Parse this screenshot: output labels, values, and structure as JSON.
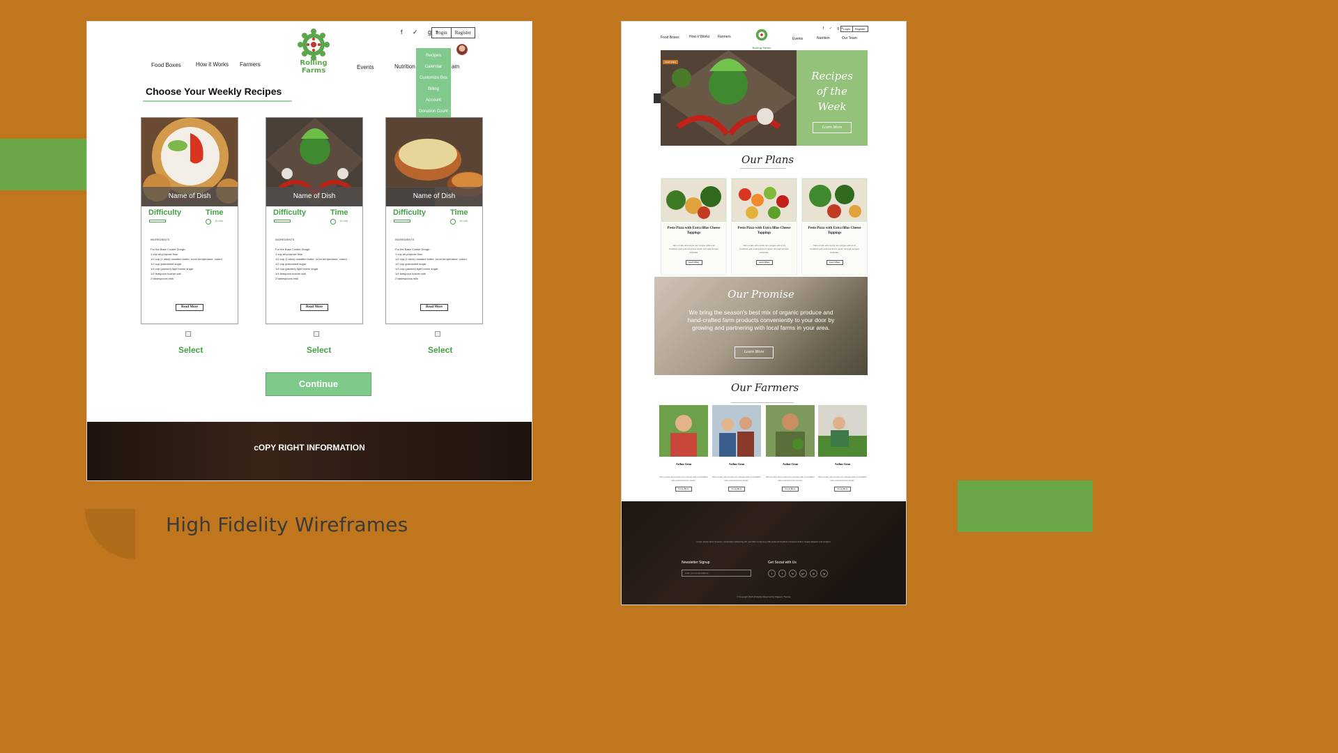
{
  "caption": "High Fidelity Wireframes",
  "colors": {
    "background": "#bf761c",
    "accent_green": "#6aa847",
    "button_green": "#7fc98a",
    "text_green": "#43a047"
  },
  "left": {
    "social_icons": [
      "facebook-icon",
      "twitter-icon",
      "google-plus-icon"
    ],
    "social_glyphs": "f  ✓  g+",
    "login": "Login",
    "register": "Register",
    "nav": {
      "food_boxes": "Food Boxes",
      "how_it_works": "How it Works",
      "farmers": "Farmers",
      "events": "Events",
      "nutrition": "Nutrition",
      "team_partial": "am"
    },
    "brand": "Rolling Farms",
    "dropdown": [
      "Recipes",
      "Calendar",
      "Customize Box",
      "Billing",
      "Account",
      "Donation Count"
    ],
    "heading": "Choose Your Weekly  Recipes",
    "cards": [
      {
        "name": "Name of Dish",
        "difficulty": "Difficulty",
        "time": "Time",
        "minutes": "10 min",
        "ingredients_label": "INGREDIENTS",
        "ingredients": [
          "For the Base Cookie Dough:",
          "1 cup all-purpose flour",
          "1/2 cup (1 stick) unsalted butter, room temperature, cubed",
          "1/2 cup granulated sugar",
          "1/4 cup (packed) light brown sugar",
          "1/4 teaspoon kosher salt",
          "2 tablespoons milk"
        ],
        "read_more": "Read More",
        "select": "Select"
      },
      {
        "name": "Name of Dish",
        "difficulty": "Difficulty",
        "time": "Time",
        "minutes": "10 min",
        "ingredients_label": "INGREDIENTS",
        "ingredients": [
          "For the Base Cookie Dough:",
          "1 cup all-purpose flour",
          "1/2 cup (1 stick) unsalted butter, room temperature, cubed",
          "1/2 cup granulated sugar",
          "1/4 cup (packed) light brown sugar",
          "1/4 teaspoon kosher salt",
          "2 tablespoons milk"
        ],
        "read_more": "Read More",
        "select": "Select"
      },
      {
        "name": "Name of Dish",
        "difficulty": "Difficulty",
        "time": "Time",
        "minutes": "10 min",
        "ingredients_label": "INGREDIENTS",
        "ingredients": [
          "For the Base Cookie Dough:",
          "1 cup all-purpose flour",
          "1/2 cup (1 stick) unsalted butter, room temperature, cubed",
          "1/2 cup granulated sugar",
          "1/4 cup (packed) light brown sugar",
          "1/4 teaspoon kosher salt",
          "2 tablespoons milk"
        ],
        "read_more": "Read More",
        "select": "Select"
      }
    ],
    "continue": "Continue",
    "copyright": "cOPY RIGHT INFORMATION"
  },
  "right": {
    "nav": {
      "food_boxes": "Food Boxes",
      "how_it_works": "How it Works",
      "farmers": "Farmers",
      "events": "Events",
      "nutrition": "Nutrition",
      "our_team": "Our Team"
    },
    "social_glyphs": "f ✓ g+",
    "login": "Login",
    "register": "Register",
    "brand": "Rolling Farms",
    "hero": {
      "tag": "FEATURED",
      "title_lines": [
        "Recipes",
        "of the",
        "Week"
      ],
      "button": "Learn More"
    },
    "plans": {
      "title": "Our Plans",
      "items": [
        {
          "title": "Pesto Pizza with Extra fillas Cheese Toppings",
          "desc": "Nam ornare arcu turpis nec congue velit ut sit Curabitur quis euismod lorem ipsum nisl eget semper vulputate.",
          "button": "Learn More"
        },
        {
          "title": "Pesto Pizza with Extra fillas Cheese Toppings",
          "desc": "Nam ornare arcu turpis nec congue velit ut sit Curabitur quis euismod lorem ipsum nisl eget semper vulputate.",
          "button": "Learn More"
        },
        {
          "title": "Pesto Pizza with Extra fillas Cheese Toppings",
          "desc": "Nam ornare arcu turpis nec congue velit ut sit Curabitur quis euismod lorem ipsum nisl eget semper vulputate.",
          "button": "Learn More"
        }
      ]
    },
    "promise": {
      "title": "Our Promise",
      "text": "We bring the season's best mix of organic produce and hand-crafted farm products conveniently to your door by growing and partnering with local farms in your area.",
      "button": "Learn More"
    },
    "farmers": {
      "title": "Our Farmers",
      "items": [
        {
          "name": "Arthur Gean",
          "desc": "Nam ornare arcu turpis nec congue velit ut Curabitur quis euismod lorem ipsum.",
          "button": "Know More"
        },
        {
          "name": "Arthur Gean",
          "desc": "Nam ornare arcu turpis nec congue velit ut Curabitur quis euismod lorem ipsum.",
          "button": "Know More"
        },
        {
          "name": "Arthur Gean",
          "desc": "Nam ornare arcu turpis nec congue velit ut Curabitur quis euismod lorem ipsum.",
          "button": "Know More"
        },
        {
          "name": "Arthur Gean",
          "desc": "Nam ornare arcu turpis nec congue velit ut Curabitur quis euismod lorem ipsum.",
          "button": "Know More"
        }
      ]
    },
    "footer": {
      "lorem": "Lorem ipsum dolor sit amet, consectetur adipiscing elit, sed diam nonummy nibh euismod tincidunt ut laoreet dolore magna aliquam erat volutpat.",
      "newsletter": "Newsletter Signup",
      "email_placeholder": "Enter your email address",
      "social": "Get Social with Us",
      "social_icons": [
        "f",
        "t",
        "in",
        "g+",
        "yt",
        "ig"
      ],
      "copyright": "© Copyright 2016 All Rights Reserved by Majestic Themes"
    }
  }
}
